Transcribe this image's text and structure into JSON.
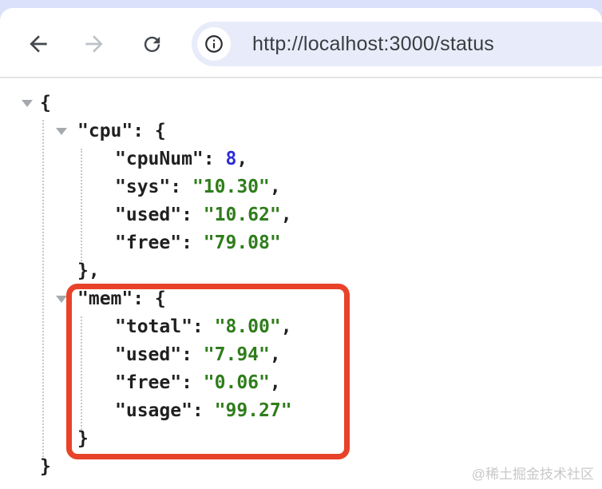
{
  "toolbar": {
    "url": "http://localhost:3000/status",
    "icons": [
      "back-arrow-icon",
      "forward-arrow-icon",
      "reload-icon",
      "info-icon"
    ]
  },
  "viewer": {
    "lines": [
      {
        "prefix": "{",
        "value": "",
        "tail": ""
      },
      {
        "prefix": "\"cpu\": {",
        "value": "",
        "tail": ""
      },
      {
        "prefix": "\"cpuNum\": ",
        "value": "8",
        "tail": ","
      },
      {
        "prefix": "\"sys\": ",
        "value": "\"10.30\"",
        "tail": ","
      },
      {
        "prefix": "\"used\": ",
        "value": "\"10.62\"",
        "tail": ","
      },
      {
        "prefix": "\"free\": ",
        "value": "\"79.08\"",
        "tail": ""
      },
      {
        "prefix": "},",
        "value": "",
        "tail": ""
      },
      {
        "prefix": "\"mem\": {",
        "value": "",
        "tail": ""
      },
      {
        "prefix": "\"total\": ",
        "value": "\"8.00\"",
        "tail": ","
      },
      {
        "prefix": "\"used\": ",
        "value": "\"7.94\"",
        "tail": ","
      },
      {
        "prefix": "\"free\": ",
        "value": "\"0.06\"",
        "tail": ","
      },
      {
        "prefix": "\"usage\": ",
        "value": "\"99.27\"",
        "tail": ""
      },
      {
        "prefix": "}",
        "value": "",
        "tail": ""
      },
      {
        "prefix": "}",
        "value": "",
        "tail": ""
      }
    ]
  },
  "watermark": "@稀土掘金技术社区",
  "colors": {
    "highlight_red": "#e8432a",
    "string_green": "#2f7d1b",
    "number_blue": "#2c2cd8",
    "address_bar_bg": "#e8ecfa",
    "tab_strip_bg": "#dbe1fa"
  }
}
